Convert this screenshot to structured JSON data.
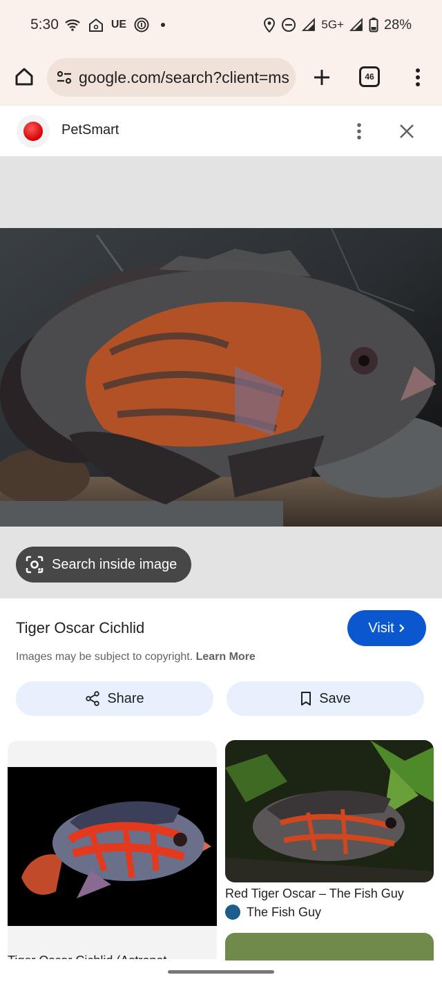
{
  "status_bar": {
    "time": "5:30",
    "carrier_badge": "UE",
    "network": "5G+",
    "battery": "28%",
    "icons": [
      "wifi-icon",
      "home-icon",
      "fingerprint-icon",
      "location-icon",
      "dnd-icon",
      "signal-icon",
      "battery-icon"
    ]
  },
  "browser": {
    "url": "google.com/search?client=ms",
    "tab_count": "46"
  },
  "source": {
    "name": "PetSmart",
    "brand_color": "#d40000"
  },
  "viewer": {
    "lens_label": "Search inside image"
  },
  "result": {
    "title": "Tiger Oscar Cichlid",
    "visit_label": "Visit",
    "copyright_text": "Images may be subject to copyright.",
    "learn_more": "Learn More",
    "share_label": "Share",
    "save_label": "Save",
    "accent_color": "#0b57d0"
  },
  "related": [
    {
      "caption": "Tiger Oscar Cichlid (Astronot"
    },
    {
      "caption": "Red Tiger Oscar – The Fish Guy",
      "source": "The Fish Guy"
    }
  ]
}
